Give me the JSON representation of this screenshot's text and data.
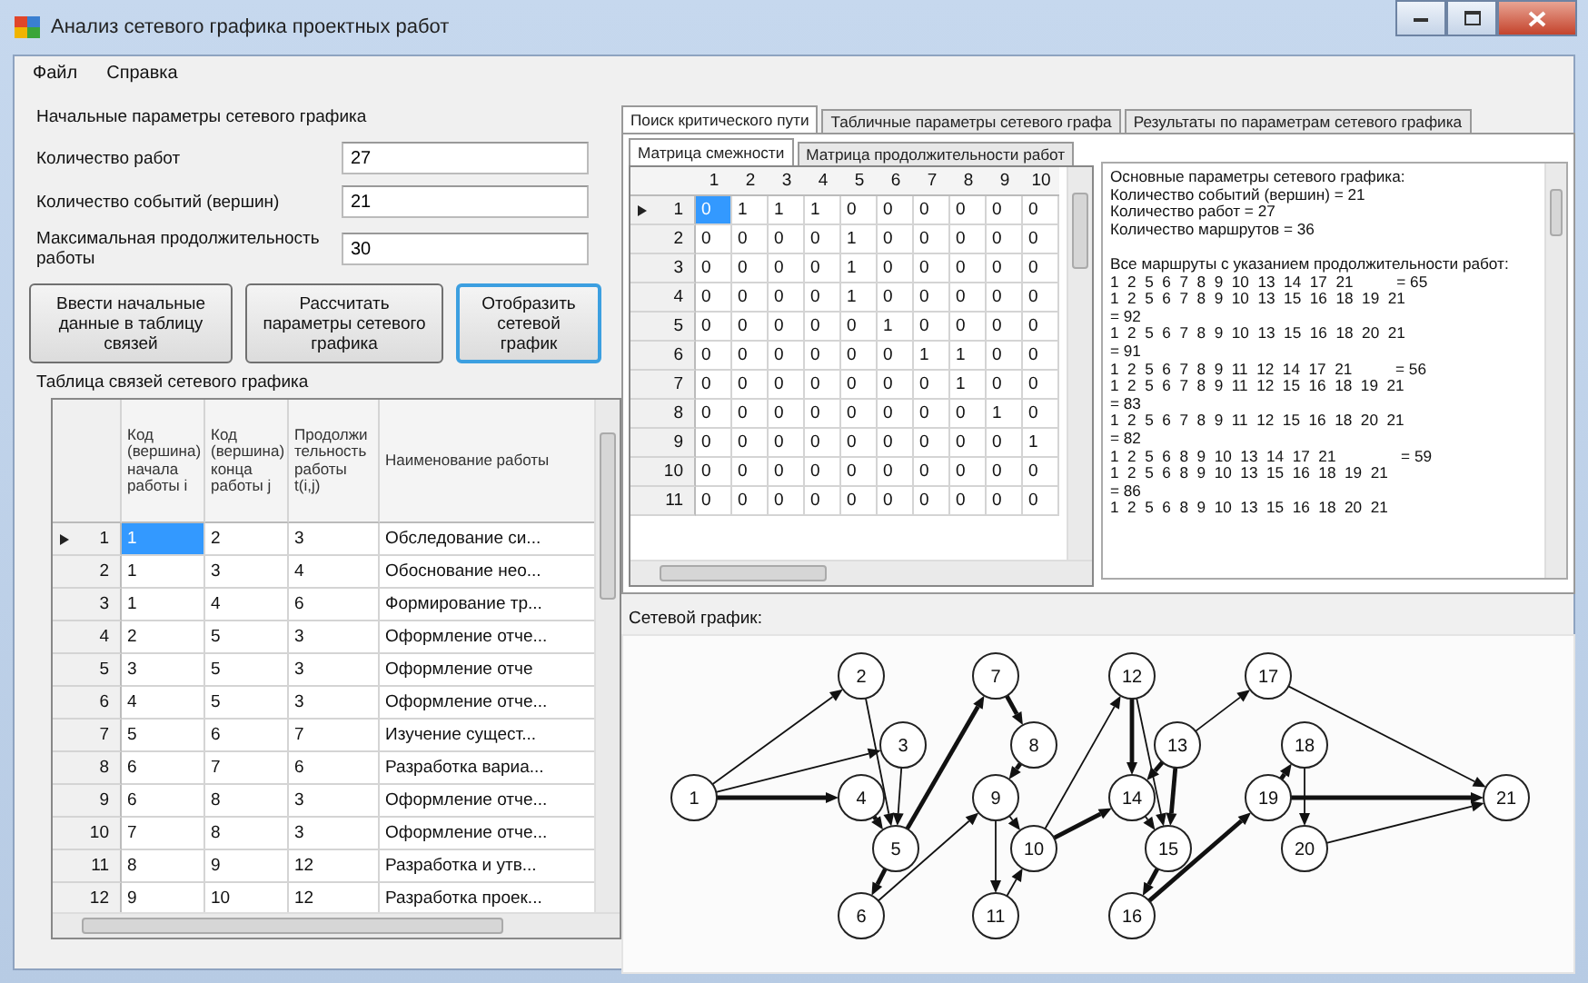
{
  "window": {
    "title": "Анализ сетевого графика проектных работ"
  },
  "menu": [
    {
      "label": "Файл"
    },
    {
      "label": "Справка"
    }
  ],
  "parameters": {
    "title": "Начальные параметры сетевого графика",
    "fields": [
      {
        "label": "Количество работ",
        "value": "27"
      },
      {
        "label": "Количество событий (вершин)",
        "value": "21"
      },
      {
        "label": "Максимальная продолжительность работы",
        "value": "30"
      }
    ]
  },
  "buttons": [
    {
      "label": "Ввести начальные данные в таблицу связей",
      "focused": false
    },
    {
      "label": "Рассчитать параметры сетевого графика",
      "focused": false
    },
    {
      "label": "Отобразить сетевой график",
      "focused": true
    }
  ],
  "links_table": {
    "title": "Таблица связей сетевого графика",
    "columns": [
      "Код (вершина) начала работы i",
      "Код (вершина) конца работы j",
      "Продолжи тельность работы t(i,j)",
      "Наименование работы"
    ],
    "rows": [
      {
        "number": "1",
        "current": true,
        "cells": [
          "1",
          "2",
          "3",
          "Обследование си..."
        ]
      },
      {
        "number": "2",
        "current": false,
        "cells": [
          "1",
          "3",
          "4",
          "Обоснование нео..."
        ]
      },
      {
        "number": "3",
        "current": false,
        "cells": [
          "1",
          "4",
          "6",
          "Формирование тр..."
        ]
      },
      {
        "number": "4",
        "current": false,
        "cells": [
          "2",
          "5",
          "3",
          "Оформление отче..."
        ]
      },
      {
        "number": "5",
        "current": false,
        "cells": [
          "3",
          "5",
          "3",
          "Оформление отче"
        ]
      },
      {
        "number": "6",
        "current": false,
        "cells": [
          "4",
          "5",
          "3",
          "Оформление отче..."
        ]
      },
      {
        "number": "7",
        "current": false,
        "cells": [
          "5",
          "6",
          "7",
          "Изучение сущест..."
        ]
      },
      {
        "number": "8",
        "current": false,
        "cells": [
          "6",
          "7",
          "6",
          "Разработка вариа..."
        ]
      },
      {
        "number": "9",
        "current": false,
        "cells": [
          "6",
          "8",
          "3",
          "Оформление отче..."
        ]
      },
      {
        "number": "10",
        "current": false,
        "cells": [
          "7",
          "8",
          "3",
          "Оформление отче..."
        ]
      },
      {
        "number": "11",
        "current": false,
        "cells": [
          "8",
          "9",
          "12",
          "Разработка и утв..."
        ]
      },
      {
        "number": "12",
        "current": false,
        "cells": [
          "9",
          "10",
          "12",
          "Разработка проек..."
        ]
      }
    ]
  },
  "tabs": [
    {
      "label": "Поиск критического пути",
      "selected": true
    },
    {
      "label": "Табличные параметры сетевого графа",
      "selected": false
    },
    {
      "label": "Результаты по параметрам сетевого графика",
      "selected": false
    }
  ],
  "subtabs": [
    {
      "label": "Матрица смежности",
      "selected": true
    },
    {
      "label": "Матрица продолжительности работ",
      "selected": false
    }
  ],
  "adjacency_matrix": {
    "columns": [
      "1",
      "2",
      "3",
      "4",
      "5",
      "6",
      "7",
      "8",
      "9",
      "10"
    ],
    "rows": [
      {
        "number": "1",
        "current": true,
        "cells": [
          "0",
          "1",
          "1",
          "1",
          "0",
          "0",
          "0",
          "0",
          "0",
          "0"
        ]
      },
      {
        "number": "2",
        "current": false,
        "cells": [
          "0",
          "0",
          "0",
          "0",
          "1",
          "0",
          "0",
          "0",
          "0",
          "0"
        ]
      },
      {
        "number": "3",
        "current": false,
        "cells": [
          "0",
          "0",
          "0",
          "0",
          "1",
          "0",
          "0",
          "0",
          "0",
          "0"
        ]
      },
      {
        "number": "4",
        "current": false,
        "cells": [
          "0",
          "0",
          "0",
          "0",
          "1",
          "0",
          "0",
          "0",
          "0",
          "0"
        ]
      },
      {
        "number": "5",
        "current": false,
        "cells": [
          "0",
          "0",
          "0",
          "0",
          "0",
          "1",
          "0",
          "0",
          "0",
          "0"
        ]
      },
      {
        "number": "6",
        "current": false,
        "cells": [
          "0",
          "0",
          "0",
          "0",
          "0",
          "0",
          "1",
          "1",
          "0",
          "0"
        ]
      },
      {
        "number": "7",
        "current": false,
        "cells": [
          "0",
          "0",
          "0",
          "0",
          "0",
          "0",
          "0",
          "1",
          "0",
          "0"
        ]
      },
      {
        "number": "8",
        "current": false,
        "cells": [
          "0",
          "0",
          "0",
          "0",
          "0",
          "0",
          "0",
          "0",
          "1",
          "0"
        ]
      },
      {
        "number": "9",
        "current": false,
        "cells": [
          "0",
          "0",
          "0",
          "0",
          "0",
          "0",
          "0",
          "0",
          "0",
          "1"
        ]
      },
      {
        "number": "10",
        "current": false,
        "cells": [
          "0",
          "0",
          "0",
          "0",
          "0",
          "0",
          "0",
          "0",
          "0",
          "0"
        ]
      },
      {
        "number": "11",
        "current": false,
        "cells": [
          "0",
          "0",
          "0",
          "0",
          "0",
          "0",
          "0",
          "0",
          "0",
          "0"
        ]
      }
    ]
  },
  "results": {
    "summary": [
      "Основные параметры сетевого графика:",
      "Количество событий (вершин) = 21",
      "Количество работ = 27",
      "Количество маршрутов = 36"
    ],
    "routes_heading": "Все маршруты с указанием продолжительности работ:",
    "routes": [
      "1  2  5  6  7  8  9  10  13  14  17  21          = 65",
      "1  2  5  6  7  8  9  10  13  15  16  18  19  21",
      "= 92",
      "1  2  5  6  7  8  9  10  13  15  16  18  20  21",
      "= 91",
      "1  2  5  6  7  8  9  11  12  14  17  21          = 56",
      "1  2  5  6  7  8  9  11  12  15  16  18  19  21",
      "= 83",
      "1  2  5  6  7  8  9  11  12  15  16  18  20  21",
      "= 82",
      "1  2  5  6  8  9  10  13  14  17  21               = 59",
      "1  2  5  6  8  9  10  13  15  16  18  19  21",
      "= 86",
      "1  2  5  6  8  9  10  13  15  16  18  20  21"
    ]
  },
  "network_graph": {
    "title": "Сетевой график:",
    "nodes": [
      {
        "label": "1"
      },
      {
        "label": "2"
      },
      {
        "label": "3"
      },
      {
        "label": "4"
      },
      {
        "label": "5"
      },
      {
        "label": "6"
      },
      {
        "label": "7"
      },
      {
        "label": "8"
      },
      {
        "label": "9"
      },
      {
        "label": "10"
      },
      {
        "label": "11"
      },
      {
        "label": "12"
      },
      {
        "label": "13"
      },
      {
        "label": "14"
      },
      {
        "label": "15"
      },
      {
        "label": "16"
      },
      {
        "label": "17"
      },
      {
        "label": "18"
      },
      {
        "label": "19"
      },
      {
        "label": "20"
      },
      {
        "label": "21"
      }
    ],
    "edges": [
      {
        "critical": false
      },
      {
        "critical": false
      },
      {
        "critical": true
      },
      {
        "critical": false
      },
      {
        "critical": false
      },
      {
        "critical": true
      },
      {
        "critical": true
      },
      {
        "critical": true
      },
      {
        "critical": false
      },
      {
        "critical": true
      },
      {
        "critical": true
      },
      {
        "critical": false
      },
      {
        "critical": false
      },
      {
        "critical": false
      },
      {
        "critical": false
      },
      {
        "critical": true
      },
      {
        "critical": true
      },
      {
        "critical": false
      },
      {
        "critical": true
      },
      {
        "critical": true
      },
      {
        "critical": false
      },
      {
        "critical": false
      },
      {
        "critical": true
      },
      {
        "critical": true
      },
      {
        "critical": true
      },
      {
        "critical": false
      },
      {
        "critical": true
      },
      {
        "critical": false
      },
      {
        "critical": false
      }
    ]
  }
}
